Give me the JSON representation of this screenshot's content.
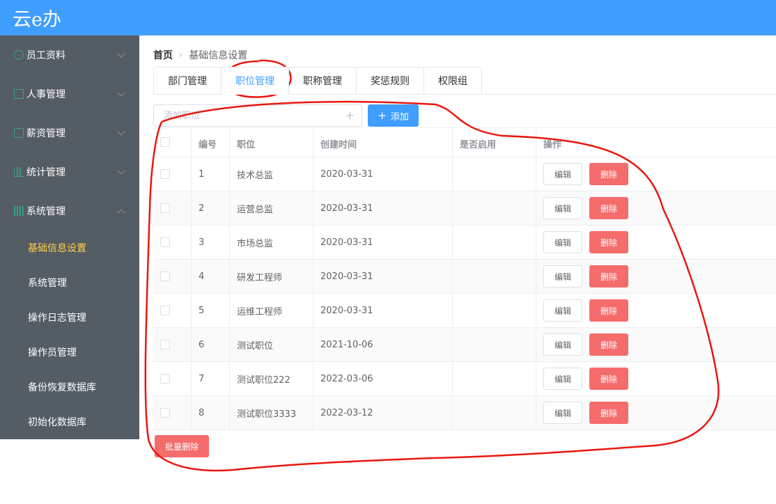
{
  "app": {
    "title": "云e办"
  },
  "sidebar": {
    "menus": [
      {
        "label": "员工资料",
        "icon": "user-icon"
      },
      {
        "label": "人事管理",
        "icon": "document-icon"
      },
      {
        "label": "薪资管理",
        "icon": "money-icon"
      },
      {
        "label": "统计管理",
        "icon": "chart-icon"
      },
      {
        "label": "系统管理",
        "icon": "grid-icon",
        "expanded": true
      }
    ],
    "items": [
      {
        "label": "基础信息设置",
        "active": true
      },
      {
        "label": "系统管理"
      },
      {
        "label": "操作日志管理"
      },
      {
        "label": "操作员管理"
      },
      {
        "label": "备份恢复数据库"
      },
      {
        "label": "初始化数据库"
      }
    ]
  },
  "breadcrumb": {
    "home": "首页",
    "current": "基础信息设置"
  },
  "tabs": [
    {
      "label": "部门管理"
    },
    {
      "label": "职位管理",
      "active": true
    },
    {
      "label": "职称管理"
    },
    {
      "label": "奖惩规则"
    },
    {
      "label": "权限组"
    }
  ],
  "toolbar": {
    "input_placeholder": "添加职位",
    "add_label": "添加"
  },
  "table": {
    "headers": {
      "id": "编号",
      "name": "职位",
      "created": "创建时间",
      "enabled": "是否启用",
      "ops": "操作"
    },
    "rows": [
      {
        "id": "1",
        "name": "技术总监",
        "created": "2020-03-31"
      },
      {
        "id": "2",
        "name": "运营总监",
        "created": "2020-03-31"
      },
      {
        "id": "3",
        "name": "市场总监",
        "created": "2020-03-31"
      },
      {
        "id": "4",
        "name": "研发工程师",
        "created": "2020-03-31"
      },
      {
        "id": "5",
        "name": "运维工程师",
        "created": "2020-03-31"
      },
      {
        "id": "6",
        "name": "测试职位",
        "created": "2021-10-06"
      },
      {
        "id": "7",
        "name": "测试职位222",
        "created": "2022-03-06"
      },
      {
        "id": "8",
        "name": "测试职位3333",
        "created": "2022-03-12"
      }
    ],
    "edit_label": "编辑",
    "delete_label": "删除"
  },
  "footer": {
    "batch_delete_label": "批量删除"
  },
  "colors": {
    "header": "#409eff",
    "sidebar": "#545c64",
    "active_menu": "#ffd04b",
    "danger": "#f56c6c",
    "annotation": "#e8170f"
  }
}
